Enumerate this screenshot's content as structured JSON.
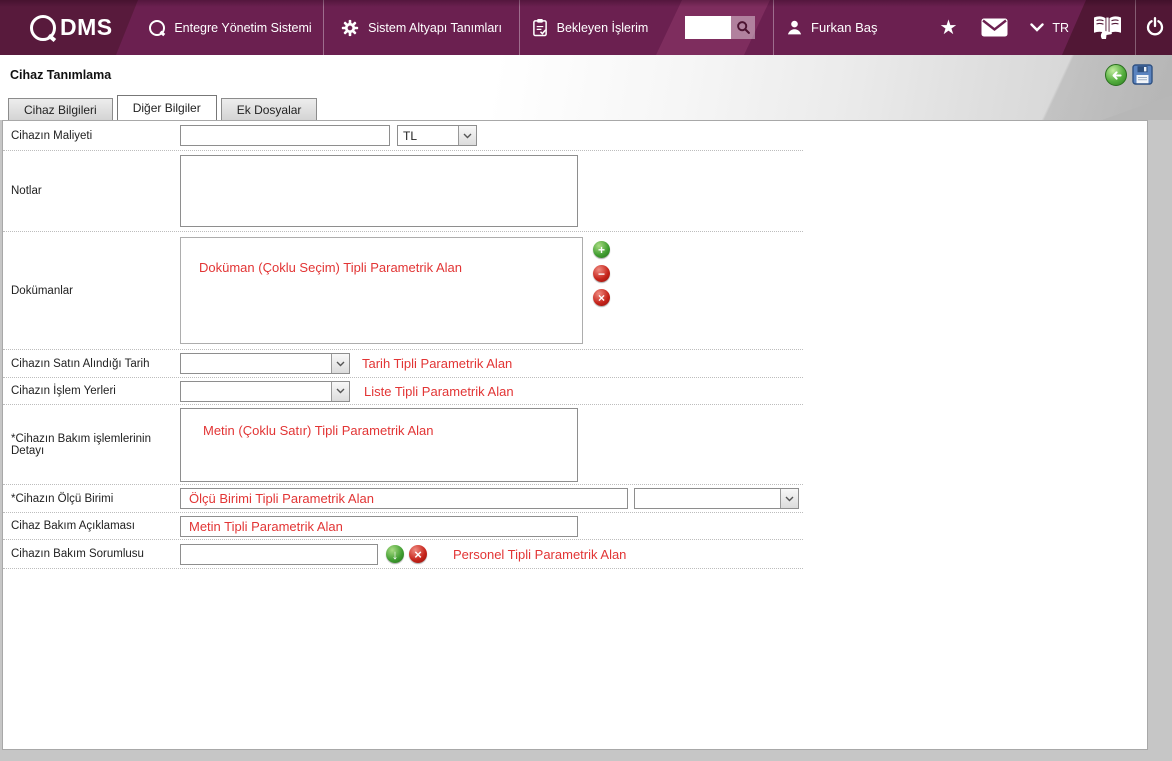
{
  "topbar": {
    "logo": {
      "text": "DMS"
    },
    "menu": [
      {
        "label": "Entegre Yönetim Sistemi"
      },
      {
        "label": "Sistem Altyapı Tanımları"
      },
      {
        "label": "Bekleyen İşlerim"
      }
    ],
    "search": {
      "value": "",
      "placeholder": ""
    },
    "user_name": "Furkan Baş",
    "language": "TR"
  },
  "header": {
    "title": "Cihaz Tanımlama"
  },
  "tabs": [
    {
      "label": "Cihaz Bilgileri",
      "active": false
    },
    {
      "label": "Diğer Bilgiler",
      "active": true
    },
    {
      "label": "Ek Dosyalar",
      "active": false
    }
  ],
  "form": {
    "rows": [
      {
        "label": "Cihazın Maliyeti",
        "value": "",
        "currency": "TL"
      },
      {
        "label": "Notlar",
        "value": ""
      },
      {
        "label": "Dokümanlar",
        "annotation": "Doküman (Çoklu Seçim) Tipli Parametrik Alan"
      },
      {
        "label": "Cihazın Satın Alındığı Tarih",
        "value": "",
        "annotation": "Tarih Tipli Parametrik Alan"
      },
      {
        "label": "Cihazın İşlem Yerleri",
        "value": "",
        "annotation": "Liste Tipli Parametrik Alan"
      },
      {
        "label": "*Cihazın Bakım işlemlerinin Detayı",
        "annotation": "Metin (Çoklu Satır) Tipli Parametrik Alan"
      },
      {
        "label": "*Cihazın Ölçü Birimi",
        "value": "",
        "annotation": "Ölçü Birimi Tipli Parametrik Alan"
      },
      {
        "label": "Cihaz Bakım Açıklaması",
        "annotation": "Metin Tipli Parametrik Alan"
      },
      {
        "label": "Cihazın Bakım Sorumlusu",
        "value": "",
        "annotation": "Personel Tipli Parametrik Alan"
      }
    ]
  },
  "colors": {
    "topbar_bg": "#6b2050",
    "topbar_dark": "#581a3c",
    "topbar_light": "#7e2d5e",
    "annotation_red": "#e23535",
    "icon_green": "#3f9c30",
    "icon_red": "#c5231a",
    "back_green": "#54ae3e",
    "save_blue": "#5b84c0"
  }
}
